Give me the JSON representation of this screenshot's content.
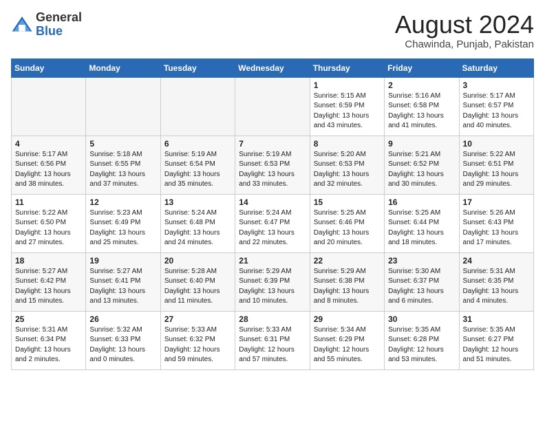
{
  "header": {
    "logo_general": "General",
    "logo_blue": "Blue",
    "month_title": "August 2024",
    "location": "Chawinda, Punjab, Pakistan"
  },
  "days_of_week": [
    "Sunday",
    "Monday",
    "Tuesday",
    "Wednesday",
    "Thursday",
    "Friday",
    "Saturday"
  ],
  "weeks": [
    [
      {
        "day": "",
        "empty": true
      },
      {
        "day": "",
        "empty": true
      },
      {
        "day": "",
        "empty": true
      },
      {
        "day": "",
        "empty": true
      },
      {
        "day": "1",
        "sunrise": "5:15 AM",
        "sunset": "6:59 PM",
        "daylight": "13 hours and 43 minutes."
      },
      {
        "day": "2",
        "sunrise": "5:16 AM",
        "sunset": "6:58 PM",
        "daylight": "13 hours and 41 minutes."
      },
      {
        "day": "3",
        "sunrise": "5:17 AM",
        "sunset": "6:57 PM",
        "daylight": "13 hours and 40 minutes."
      }
    ],
    [
      {
        "day": "4",
        "sunrise": "5:17 AM",
        "sunset": "6:56 PM",
        "daylight": "13 hours and 38 minutes."
      },
      {
        "day": "5",
        "sunrise": "5:18 AM",
        "sunset": "6:55 PM",
        "daylight": "13 hours and 37 minutes."
      },
      {
        "day": "6",
        "sunrise": "5:19 AM",
        "sunset": "6:54 PM",
        "daylight": "13 hours and 35 minutes."
      },
      {
        "day": "7",
        "sunrise": "5:19 AM",
        "sunset": "6:53 PM",
        "daylight": "13 hours and 33 minutes."
      },
      {
        "day": "8",
        "sunrise": "5:20 AM",
        "sunset": "6:53 PM",
        "daylight": "13 hours and 32 minutes."
      },
      {
        "day": "9",
        "sunrise": "5:21 AM",
        "sunset": "6:52 PM",
        "daylight": "13 hours and 30 minutes."
      },
      {
        "day": "10",
        "sunrise": "5:22 AM",
        "sunset": "6:51 PM",
        "daylight": "13 hours and 29 minutes."
      }
    ],
    [
      {
        "day": "11",
        "sunrise": "5:22 AM",
        "sunset": "6:50 PM",
        "daylight": "13 hours and 27 minutes."
      },
      {
        "day": "12",
        "sunrise": "5:23 AM",
        "sunset": "6:49 PM",
        "daylight": "13 hours and 25 minutes."
      },
      {
        "day": "13",
        "sunrise": "5:24 AM",
        "sunset": "6:48 PM",
        "daylight": "13 hours and 24 minutes."
      },
      {
        "day": "14",
        "sunrise": "5:24 AM",
        "sunset": "6:47 PM",
        "daylight": "13 hours and 22 minutes."
      },
      {
        "day": "15",
        "sunrise": "5:25 AM",
        "sunset": "6:46 PM",
        "daylight": "13 hours and 20 minutes."
      },
      {
        "day": "16",
        "sunrise": "5:25 AM",
        "sunset": "6:44 PM",
        "daylight": "13 hours and 18 minutes."
      },
      {
        "day": "17",
        "sunrise": "5:26 AM",
        "sunset": "6:43 PM",
        "daylight": "13 hours and 17 minutes."
      }
    ],
    [
      {
        "day": "18",
        "sunrise": "5:27 AM",
        "sunset": "6:42 PM",
        "daylight": "13 hours and 15 minutes."
      },
      {
        "day": "19",
        "sunrise": "5:27 AM",
        "sunset": "6:41 PM",
        "daylight": "13 hours and 13 minutes."
      },
      {
        "day": "20",
        "sunrise": "5:28 AM",
        "sunset": "6:40 PM",
        "daylight": "13 hours and 11 minutes."
      },
      {
        "day": "21",
        "sunrise": "5:29 AM",
        "sunset": "6:39 PM",
        "daylight": "13 hours and 10 minutes."
      },
      {
        "day": "22",
        "sunrise": "5:29 AM",
        "sunset": "6:38 PM",
        "daylight": "13 hours and 8 minutes."
      },
      {
        "day": "23",
        "sunrise": "5:30 AM",
        "sunset": "6:37 PM",
        "daylight": "13 hours and 6 minutes."
      },
      {
        "day": "24",
        "sunrise": "5:31 AM",
        "sunset": "6:35 PM",
        "daylight": "13 hours and 4 minutes."
      }
    ],
    [
      {
        "day": "25",
        "sunrise": "5:31 AM",
        "sunset": "6:34 PM",
        "daylight": "13 hours and 2 minutes."
      },
      {
        "day": "26",
        "sunrise": "5:32 AM",
        "sunset": "6:33 PM",
        "daylight": "13 hours and 0 minutes."
      },
      {
        "day": "27",
        "sunrise": "5:33 AM",
        "sunset": "6:32 PM",
        "daylight": "12 hours and 59 minutes."
      },
      {
        "day": "28",
        "sunrise": "5:33 AM",
        "sunset": "6:31 PM",
        "daylight": "12 hours and 57 minutes."
      },
      {
        "day": "29",
        "sunrise": "5:34 AM",
        "sunset": "6:29 PM",
        "daylight": "12 hours and 55 minutes."
      },
      {
        "day": "30",
        "sunrise": "5:35 AM",
        "sunset": "6:28 PM",
        "daylight": "12 hours and 53 minutes."
      },
      {
        "day": "31",
        "sunrise": "5:35 AM",
        "sunset": "6:27 PM",
        "daylight": "12 hours and 51 minutes."
      }
    ]
  ]
}
